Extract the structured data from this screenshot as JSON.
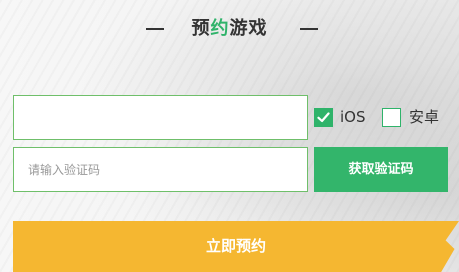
{
  "section": {
    "title_part1": "预",
    "title_accent": "约",
    "title_part2": "游戏"
  },
  "form": {
    "phone": {
      "value": "",
      "placeholder": ""
    },
    "code": {
      "value": "",
      "placeholder": "请输入验证码"
    },
    "platforms": [
      {
        "label": "iOS",
        "checked": true
      },
      {
        "label": "安卓",
        "checked": false
      }
    ],
    "get_code_label": "获取验证码",
    "submit_label": "立即预约"
  },
  "colors": {
    "accent_green": "#2fb36a",
    "input_border": "#6fbf6a",
    "submit_yellow": "#f5b731"
  }
}
